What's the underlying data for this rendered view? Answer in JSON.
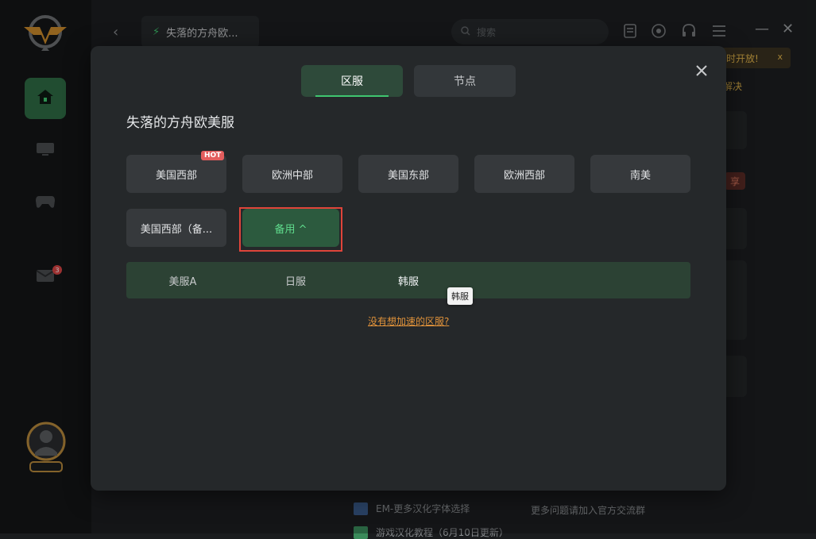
{
  "topbar": {
    "game_title": "失落的方舟欧...",
    "search_placeholder": "搜索"
  },
  "sidebar": {
    "notification_count": "3"
  },
  "background": {
    "notice": "时开放!",
    "notice_close": "x",
    "solve_text": "解决",
    "share_text": "享",
    "list_item_1": "EM-更多汉化字体选择",
    "list_item_2": "游戏汉化教程（6月10日更新）",
    "help_text": "更多问题请加入官方交流群"
  },
  "modal": {
    "tabs": [
      {
        "label": "区服",
        "active": true
      },
      {
        "label": "节点",
        "active": false
      }
    ],
    "title": "失落的方舟欧美服",
    "regions_row1": [
      {
        "label": "美国西部",
        "badge": "HOT"
      },
      {
        "label": "欧洲中部"
      },
      {
        "label": "美国东部"
      },
      {
        "label": "欧洲西部"
      },
      {
        "label": "南美"
      }
    ],
    "regions_row2": [
      {
        "label": "美国西部（备..."
      },
      {
        "label": "备用 ^",
        "selected": true
      }
    ],
    "sub_servers": [
      "美服A",
      "日服",
      "韩服"
    ],
    "tooltip": "韩服",
    "help_link": "没有想加速的区服?"
  },
  "colors": {
    "accent": "#3fc66f",
    "selected_text": "#5fdb8c",
    "link": "#e0923a",
    "hot": "#e35d5d",
    "highlight_frame": "#e0443a"
  }
}
